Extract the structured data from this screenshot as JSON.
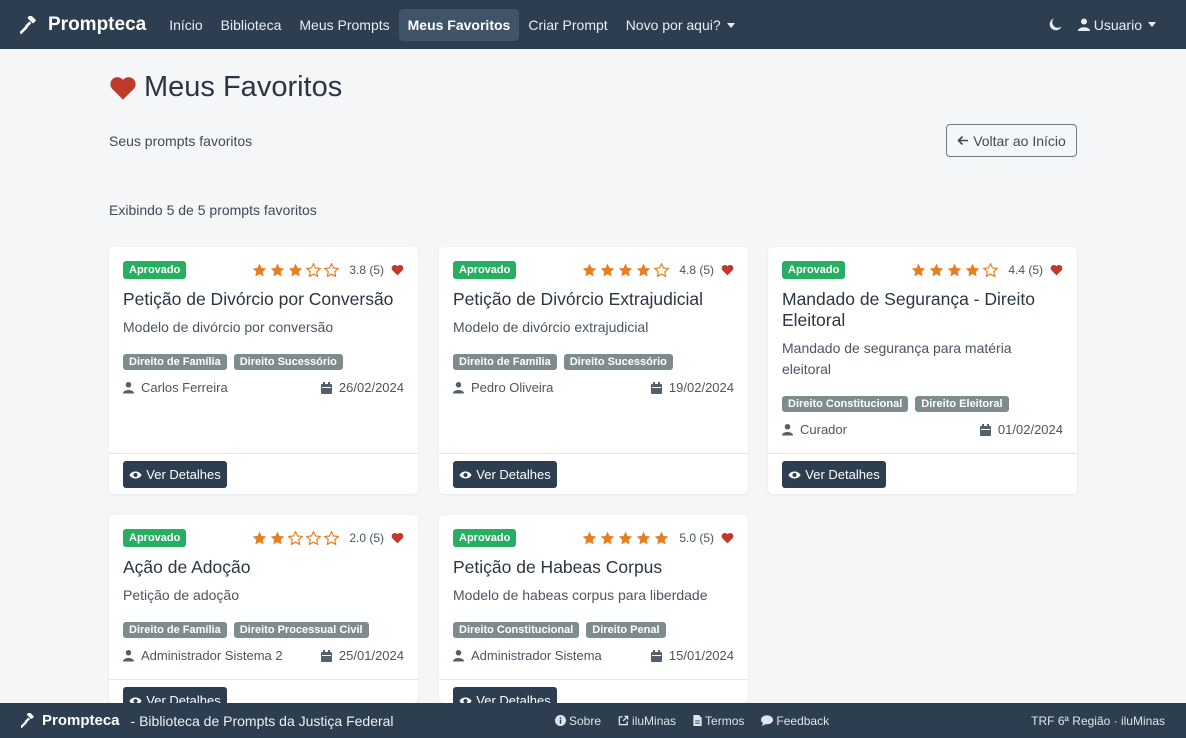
{
  "nav": {
    "brand": "Prompteca",
    "links": [
      "Início",
      "Biblioteca",
      "Meus Prompts",
      "Meus Favoritos",
      "Criar Prompt",
      "Novo por aqui?"
    ],
    "user": "Usuario"
  },
  "page": {
    "title": "Meus Favoritos",
    "subtitle": "Seus prompts favoritos",
    "back_label": "Voltar ao Início",
    "count_text": "Exibindo 5 de 5 prompts favoritos"
  },
  "cards": [
    {
      "status": "Aprovado",
      "rating": 3.8,
      "rating_text": "3.8 (5)",
      "stars_filled": 3,
      "title": "Petição de Divórcio por Conversão",
      "description": "Modelo de divórcio por conversão",
      "tags": [
        "Direito de Família",
        "Direito Sucessório"
      ],
      "author": "Carlos Ferreira",
      "date": "26/02/2024",
      "button": "Ver Detalhes"
    },
    {
      "status": "Aprovado",
      "rating": 4.8,
      "rating_text": "4.8 (5)",
      "stars_filled": 4,
      "title": "Petição de Divórcio Extrajudicial",
      "description": "Modelo de divórcio extrajudicial",
      "tags": [
        "Direito de Família",
        "Direito Sucessório"
      ],
      "author": "Pedro Oliveira",
      "date": "19/02/2024",
      "button": "Ver Detalhes"
    },
    {
      "status": "Aprovado",
      "rating": 4.4,
      "rating_text": "4.4 (5)",
      "stars_filled": 4,
      "title": "Mandado de Segurança - Direito Eleitoral",
      "description": "Mandado de segurança para matéria eleitoral",
      "tags": [
        "Direito Constitucional",
        "Direito Eleitoral"
      ],
      "author": "Curador",
      "date": "01/02/2024",
      "button": "Ver Detalhes"
    },
    {
      "status": "Aprovado",
      "rating": 2.0,
      "rating_text": "2.0 (5)",
      "stars_filled": 2,
      "title": "Ação de Adoção",
      "description": "Petição de adoção",
      "tags": [
        "Direito de Família",
        "Direito Processual Civil"
      ],
      "author": "Administrador Sistema 2",
      "date": "25/01/2024",
      "button": "Ver Detalhes"
    },
    {
      "status": "Aprovado",
      "rating": 5.0,
      "rating_text": "5.0 (5)",
      "stars_filled": 5,
      "title": "Petição de Habeas Corpus",
      "description": "Modelo de habeas corpus para liberdade",
      "tags": [
        "Direito Constitucional",
        "Direito Penal"
      ],
      "author": "Administrador Sistema",
      "date": "15/01/2024",
      "button": "Ver Detalhes"
    }
  ],
  "footer": {
    "brand": "Prompteca",
    "tagline": "- Biblioteca de Prompts da Justiça Federal",
    "links": [
      "Sobre",
      "iluMinas",
      "Termos",
      "Feedback"
    ],
    "right": "TRF 6ª Região · iluMinas"
  },
  "colors": {
    "navbar": "#2c3e50",
    "approved": "#27ae60",
    "star": "#e67e22",
    "heart": "#c0392b",
    "tag": "#7f8c8d"
  }
}
